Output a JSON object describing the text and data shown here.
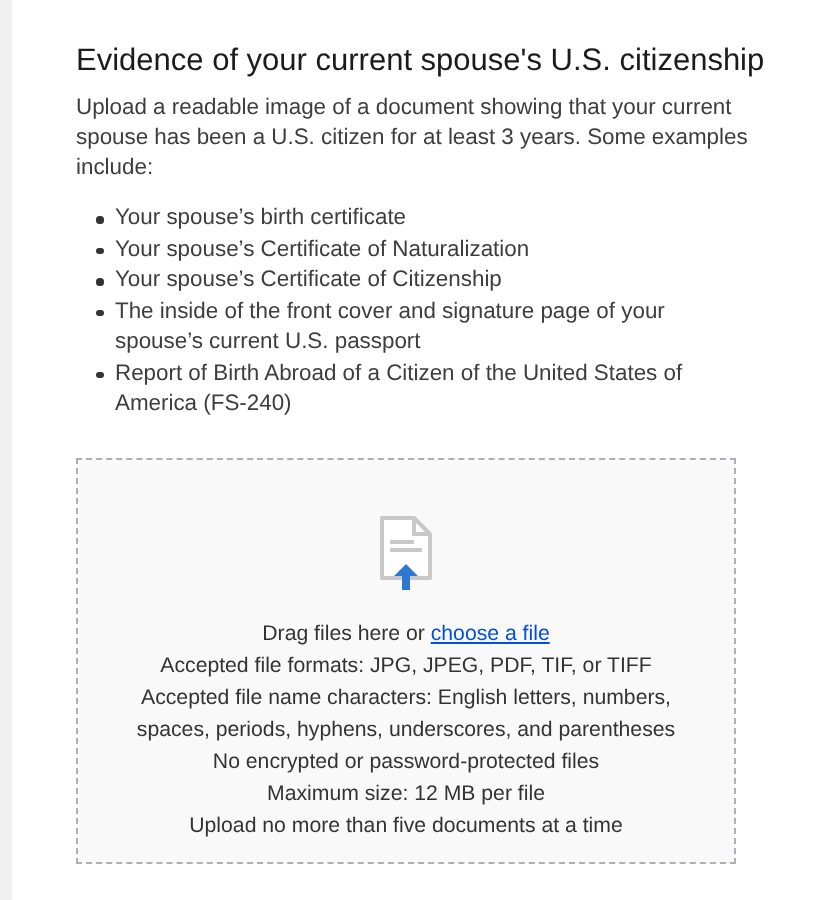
{
  "heading": "Evidence of your current spouse's U.S. citizenship",
  "intro": "Upload a readable image of a document showing that your current spouse has been a U.S. citizen for at least 3 years. Some examples include:",
  "examples": [
    "Your spouse’s birth certificate",
    "Your spouse’s Certificate of Naturalization",
    "Your spouse’s Certificate of Citizenship",
    "The inside of the front cover and signature page of your spouse’s current U.S. passport",
    "Report of Birth Abroad of a Citizen of the United States of America (FS-240)"
  ],
  "dropzone": {
    "prompt": "Drag files here or",
    "link": "choose a file",
    "rules": [
      "Accepted file formats: JPG, JPEG, PDF, TIF, or TIFF",
      "Accepted file name characters: English letters, numbers, spaces, periods, hyphens, underscores, and parentheses",
      "No encrypted or password-protected files",
      "Maximum size: 12 MB per file",
      "Upload no more than five documents at a time"
    ]
  }
}
